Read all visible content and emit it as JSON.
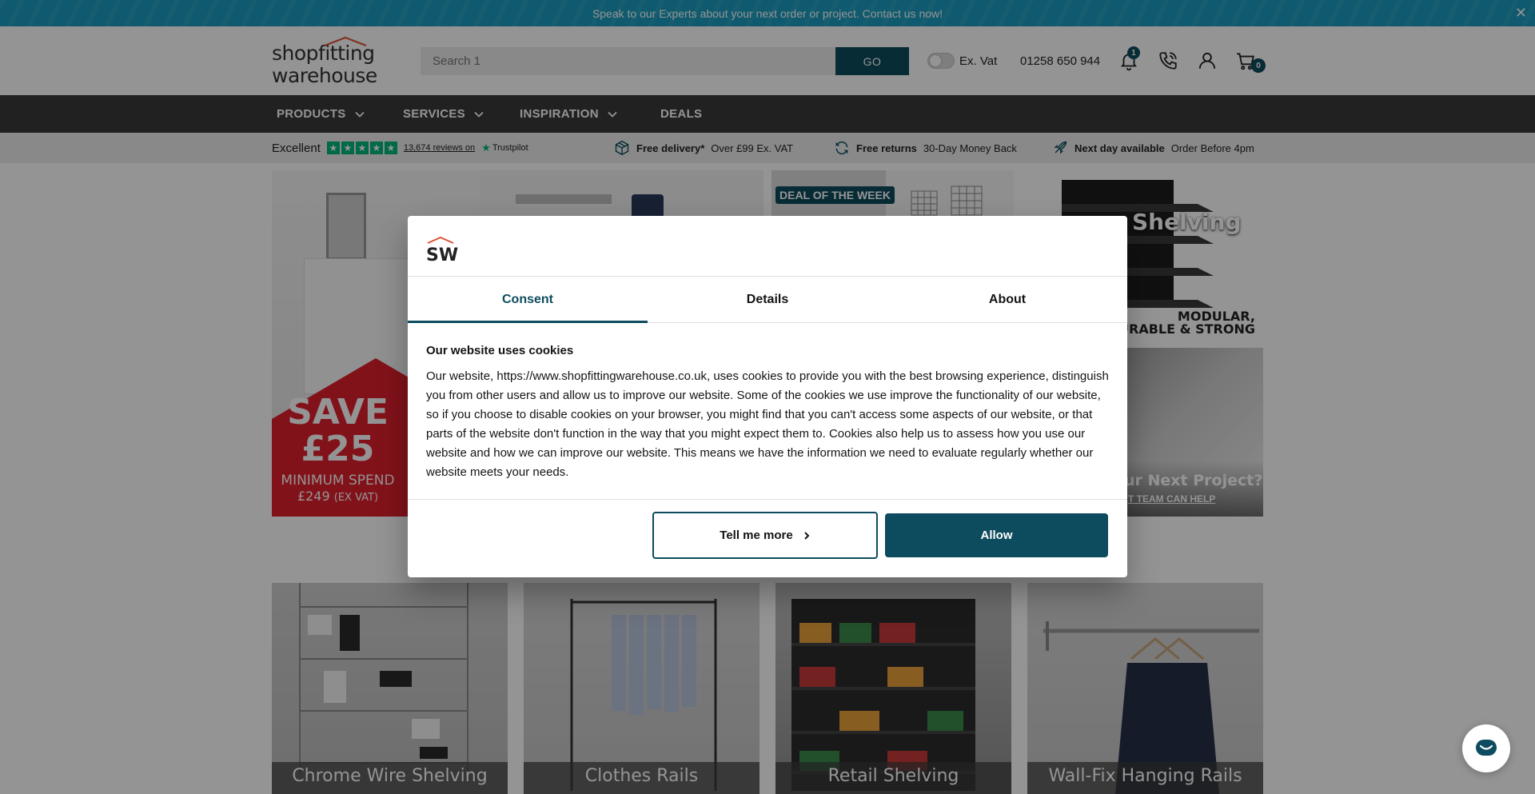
{
  "banner": {
    "text": "Speak to our Experts about your next order or project. Contact us now!",
    "close_glyph": "✕"
  },
  "header": {
    "logo_line1": "shopfitting",
    "logo_line2": "warehouse",
    "search_placeholder": "Search 1",
    "go_label": "GO",
    "vat_label": "Ex. Vat",
    "phone_number": "01258 650 944",
    "notifications_count": "1",
    "cart_count": "0",
    "icons": [
      "bell-icon",
      "phone-icon",
      "account-icon",
      "basket-icon"
    ]
  },
  "nav": {
    "items": [
      {
        "label": "PRODUCTS",
        "has_dropdown": true
      },
      {
        "label": "SERVICES",
        "has_dropdown": true
      },
      {
        "label": "INSPIRATION",
        "has_dropdown": true
      },
      {
        "label": "DEALS",
        "has_dropdown": false
      }
    ]
  },
  "usp": {
    "rating_word": "Excellent",
    "reviews_link": "13,674 reviews on",
    "trustpilot": "Trustpilot",
    "delivery_bold": "Free delivery*",
    "delivery_text": "Over £99 Ex. VAT",
    "returns_bold": "Free returns",
    "returns_text": "30-Day Money Back",
    "nextday_bold": "Next day available",
    "nextday_text": "Order Before 4pm"
  },
  "hero": {
    "save_line1": "SAVE",
    "save_line2": "£25",
    "min_spend": "MINIMUM SPEND",
    "min_amount": "£249",
    "ex_vat": "(EX VAT)",
    "deal_badge": "DEAL OF THE WEEK",
    "shelving_title": "Shelving",
    "shelving_sub1": "MODULAR,",
    "shelving_sub2": "DURABLE & STRONG",
    "project_title": "ur Next Project?",
    "project_sub": "T TEAM CAN HELP"
  },
  "categories": [
    {
      "label": "Chrome Wire Shelving"
    },
    {
      "label": "Clothes Rails"
    },
    {
      "label": "Retail Shelving"
    },
    {
      "label": "Wall-Fix Hanging Rails"
    }
  ],
  "cookie_modal": {
    "logo_text": "SW",
    "tabs": [
      {
        "label": "Consent",
        "active": true
      },
      {
        "label": "Details",
        "active": false
      },
      {
        "label": "About",
        "active": false
      }
    ],
    "heading": "Our website uses cookies",
    "body": "Our website, https://www.shopfittingwarehouse.co.uk, uses cookies to provide you with the best browsing experience, distinguish you from other users and allow us to improve our website.  Some of the cookies we use improve the functionality of our website, so if you choose to disable cookies on your browser, you might find that you can't access some aspects of our website, or that parts of the website don't function in the way that you might expect them to. Cookies also help us to assess how you use our website and how we can improve our website. This means we have the information we need to evaluate regularly whether our website meets your needs.",
    "tell_more_label": "Tell me more",
    "allow_label": "Allow"
  },
  "colors": {
    "banner": "#1b9bbd",
    "brand_dark": "#0d4c5e",
    "nav_bg": "#3a3a3a",
    "trustpilot_green": "#00b67a",
    "promo_red": "#e11f2d"
  }
}
